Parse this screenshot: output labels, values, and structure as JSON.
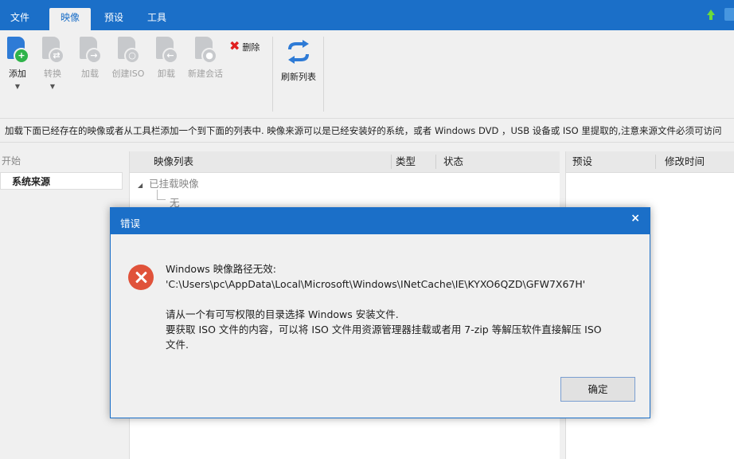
{
  "menubar": {
    "tabs": [
      {
        "label": "文件"
      },
      {
        "label": "映像",
        "active": true
      },
      {
        "label": "预设"
      },
      {
        "label": "工具"
      }
    ],
    "accent_color": "#1b6fc8"
  },
  "ribbon": {
    "add_label": "添加",
    "convert_label": "转换",
    "load_label": "加载",
    "create_iso_label": "创建ISO",
    "unload_label": "卸载",
    "new_session_label": "新建会话",
    "delete_label": "删除",
    "refresh_label": "刷新列表"
  },
  "infobar": {
    "text": "加载下面已经存在的映像或者从工具栏添加一个到下面的列表中. 映像来源可以是已经安装好的系统，或者 Windows DVD ，USB 设备或 ISO 里提取的,注意来源文件必须可访问"
  },
  "left_panel": {
    "header": "开始",
    "item": "系统来源"
  },
  "image_list": {
    "columns": {
      "name": "映像列表",
      "type": "类型",
      "status": "状态"
    },
    "group": "已挂载映像",
    "empty_child": "无"
  },
  "right_panel": {
    "columns": {
      "preset": "预设",
      "modified": "修改时间"
    }
  },
  "dialog": {
    "title": "错误",
    "close_glyph": "×",
    "icon": "error-icon",
    "line1": "Windows 映像路径无效:",
    "line2": "'C:\\Users\\pc\\AppData\\Local\\Microsoft\\Windows\\INetCache\\IE\\KYXO6QZD\\GFW7X67H'",
    "line3": "请从一个有可写权限的目录选择 Windows 安装文件.",
    "line4": "要获取 ISO 文件的内容，可以将 ISO 文件用资源管理器挂载或者用 7-zip 等解压软件直接解压 ISO",
    "line5": "文件.",
    "ok_label": "确定"
  }
}
